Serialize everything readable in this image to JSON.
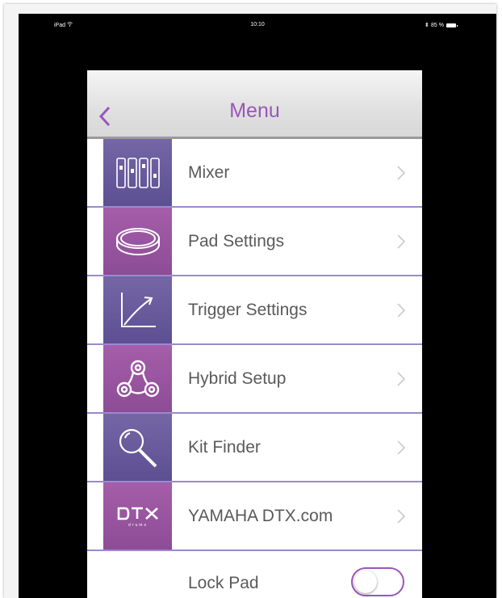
{
  "status_bar": {
    "device": "iPad",
    "time": "10:10",
    "battery": "85 %"
  },
  "nav": {
    "title": "Menu",
    "back_icon": "chevron-left-icon"
  },
  "menu": {
    "items": [
      {
        "label": "Mixer",
        "icon": "mixer-icon"
      },
      {
        "label": "Pad Settings",
        "icon": "drum-pad-icon"
      },
      {
        "label": "Trigger Settings",
        "icon": "curve-graph-icon"
      },
      {
        "label": "Hybrid Setup",
        "icon": "hybrid-icon"
      },
      {
        "label": "Kit Finder",
        "icon": "magnifier-icon"
      },
      {
        "label": "YAMAHA DTX.com",
        "icon": "dtx-logo-icon",
        "logo_text": "DTX",
        "logo_subtext": "drums"
      }
    ],
    "lock_row": {
      "label": "Lock Pad",
      "toggle_on": false
    }
  },
  "colors": {
    "accent": "#9a56b8",
    "tile_blue": "#6a5c9e",
    "tile_purple": "#9a56a0",
    "divider": "#9a8ad0"
  }
}
